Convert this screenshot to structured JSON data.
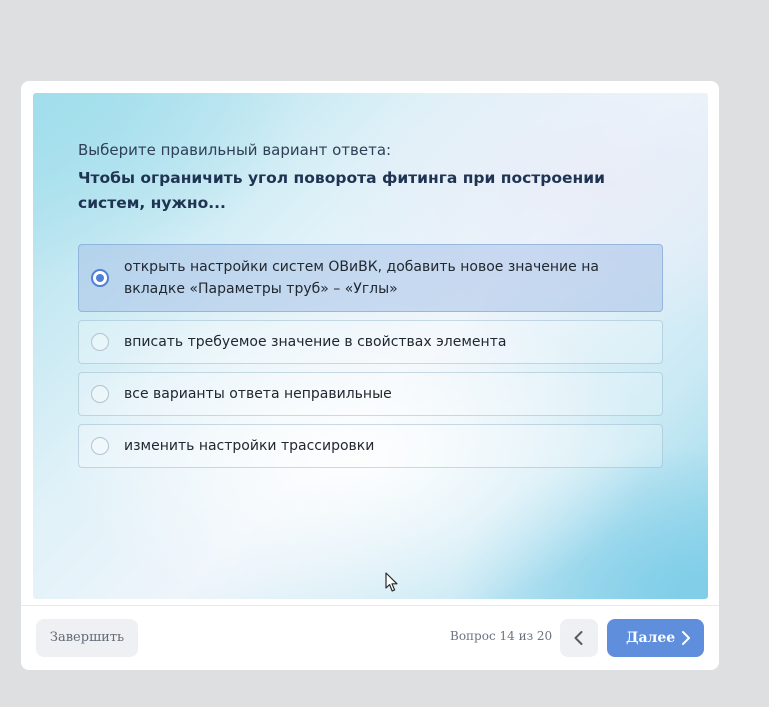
{
  "quiz": {
    "prompt": "Выберите правильный вариант ответа:",
    "question": "Чтобы ограничить угол поворота фитинга при построении систем, нужно...",
    "answers": [
      {
        "label": "открыть настройки систем ОВиВК, добавить новое значение на вкладке «Параметры труб» – «Углы»",
        "selected": true
      },
      {
        "label": "вписать требуемое значение в свойствах элемента",
        "selected": false
      },
      {
        "label": "все варианты ответа неправильные",
        "selected": false
      },
      {
        "label": "изменить настройки трассировки",
        "selected": false
      }
    ]
  },
  "footer": {
    "finish_label": "Завершить",
    "progress_text": "Вопрос 14 из 20",
    "next_label": "Далее"
  },
  "colors": {
    "accent": "#5f8fdc",
    "selected_radio": "#4f7fd6",
    "question_text": "#1f3352"
  },
  "icons": {
    "prev": "chevron-left-icon",
    "next": "chevron-right-icon",
    "cursor": "mouse-cursor-icon"
  }
}
